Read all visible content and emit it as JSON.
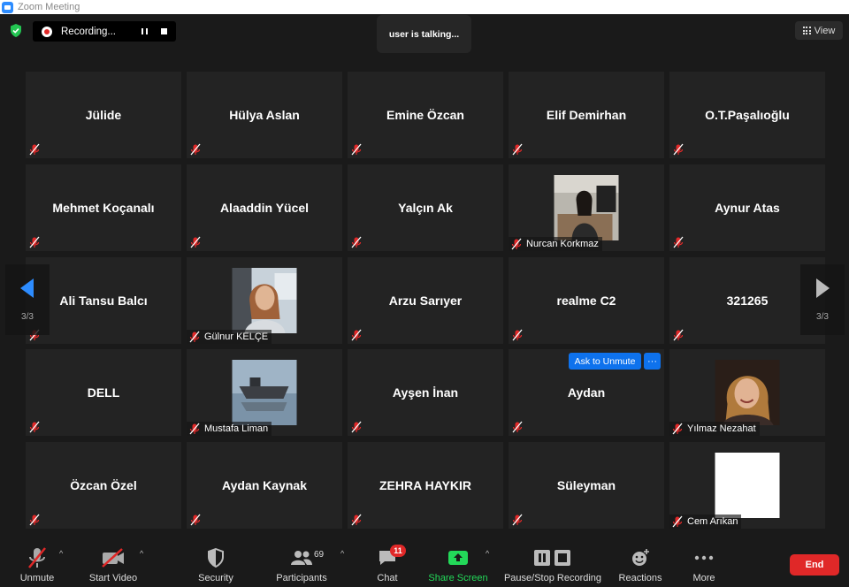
{
  "window": {
    "title": "Zoom Meeting"
  },
  "recording": {
    "label": "Recording..."
  },
  "talking_indicator": "user is talking...",
  "view_button": {
    "label": "View"
  },
  "pager": {
    "left": "3/3",
    "right": "3/3"
  },
  "tiles": [
    {
      "name": "Jülide",
      "photo": null
    },
    {
      "name": "Hülya Aslan",
      "photo": null
    },
    {
      "name": "Emine Özcan",
      "photo": null
    },
    {
      "name": "Elif Demirhan",
      "photo": null
    },
    {
      "name": "O.T.Paşalıoğlu",
      "photo": null
    },
    {
      "name": "Mehmet Koçanalı",
      "photo": null
    },
    {
      "name": "Alaaddin Yücel",
      "photo": null
    },
    {
      "name": "Yalçın Ak",
      "photo": null
    },
    {
      "name": "Nurcan Korkmaz",
      "photo": "woman-at-desk"
    },
    {
      "name": "Aynur Atas",
      "photo": null
    },
    {
      "name": "Ali Tansu Balcı",
      "photo": null
    },
    {
      "name": "Gülnur KELÇE",
      "photo": "woman-portrait"
    },
    {
      "name": "Arzu Sarıyer",
      "photo": null
    },
    {
      "name": "realme C2",
      "photo": null
    },
    {
      "name": "321265",
      "photo": null
    },
    {
      "name": "DELL",
      "photo": null
    },
    {
      "name": "Mustafa Liman",
      "photo": "boat"
    },
    {
      "name": "Ayşen İnan",
      "photo": null
    },
    {
      "name": "Aydan",
      "photo": null
    },
    {
      "name": "Yılmaz Nezahat",
      "photo": "woman-smiling"
    },
    {
      "name": "Özcan Özel",
      "photo": null
    },
    {
      "name": "Aydan Kaynak",
      "photo": null
    },
    {
      "name": "ZEHRA HAYKIR",
      "photo": null
    },
    {
      "name": "Süleyman",
      "photo": null
    },
    {
      "name": "Cem Arıkan",
      "photo": "blank-white"
    }
  ],
  "hover_tile": {
    "ask_to_unmute": "Ask to Unmute",
    "more": "···"
  },
  "toolbar": {
    "unmute": "Unmute",
    "start_video": "Start Video",
    "security": "Security",
    "participants": "Participants",
    "participants_count": "69",
    "chat": "Chat",
    "chat_badge": "11",
    "share_screen": "Share Screen",
    "pause_stop_recording": "Pause/Stop Recording",
    "reactions": "Reactions",
    "more": "More",
    "end": "End"
  },
  "colors": {
    "accent": "#0e72ed",
    "end": "#e02828",
    "share": "#23d959",
    "muted": "#e02828"
  }
}
